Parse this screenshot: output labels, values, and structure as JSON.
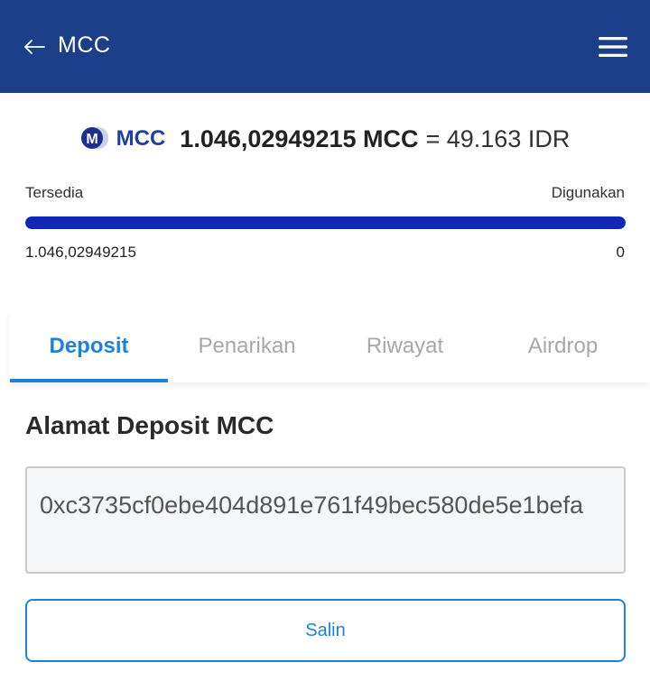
{
  "header": {
    "back_icon": "arrow-left-icon",
    "title": "MCC",
    "menu_icon": "hamburger-menu-icon",
    "background_color": "#1b4089"
  },
  "balance": {
    "logo_icon": "mcc-logo-icon",
    "coin_name": "MCC",
    "amount": "1.046,02949215 MCC",
    "equivalent": "= 49.163 IDR",
    "available_label": "Tersedia",
    "used_label": "Digunakan",
    "available_value": "1.046,02949215",
    "used_value": "0",
    "available_fraction": 1.0,
    "bar_color": "#1226b8"
  },
  "tabs": [
    {
      "label": "Deposit",
      "active": true
    },
    {
      "label": "Penarikan",
      "active": false
    },
    {
      "label": "Riwayat",
      "active": false
    },
    {
      "label": "Airdrop",
      "active": false
    }
  ],
  "deposit": {
    "title": "Alamat Deposit MCC",
    "address": "0xc3735cf0ebe404d891e761f49bec580de5e1befa",
    "copy_label": "Salin",
    "accent_color": "#1b84d6"
  }
}
